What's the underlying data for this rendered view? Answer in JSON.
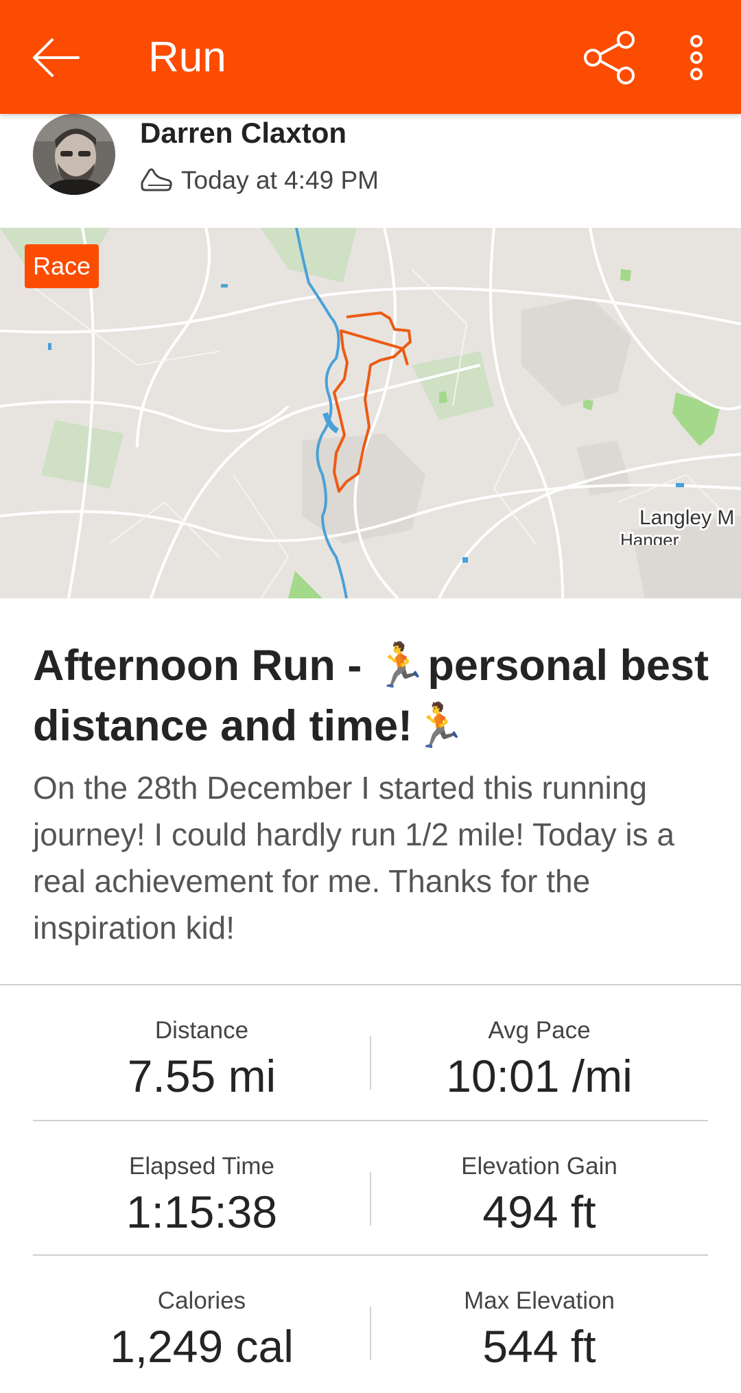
{
  "appbar": {
    "title": "Run",
    "back_icon": "arrow-left-icon",
    "share_icon": "share-icon",
    "more_icon": "more-vertical-icon"
  },
  "athlete": {
    "name": "Darren Claxton",
    "activity_icon": "shoe-icon",
    "timestamp": "Today at 4:49 PM"
  },
  "map": {
    "badge": "Race",
    "place_label_1": "Langley M",
    "place_label_2": "Hanger"
  },
  "activity": {
    "title": "Afternoon Run - ",
    "title_part2": "personal best distance and time!",
    "emoji": "🏃",
    "description": "On the 28th December I started this running journey! I could hardly run 1/2 mile! Today is a real achievement for me. Thanks for the inspiration kid!"
  },
  "stats": {
    "distance": {
      "label": "Distance",
      "value": "7.55 mi"
    },
    "avg_pace": {
      "label": "Avg Pace",
      "value": "10:01 /mi"
    },
    "elapsed_time": {
      "label": "Elapsed Time",
      "value": "1:15:38"
    },
    "elevation_gain": {
      "label": "Elevation Gain",
      "value": "494 ft"
    },
    "calories": {
      "label": "Calories",
      "value": "1,249 cal"
    },
    "max_elevation": {
      "label": "Max Elevation",
      "value": "544 ft"
    }
  },
  "colors": {
    "brand": "#fc4c02",
    "route": "#ec5a12",
    "water": "#4aa0d8",
    "park": "#a4d88a"
  }
}
